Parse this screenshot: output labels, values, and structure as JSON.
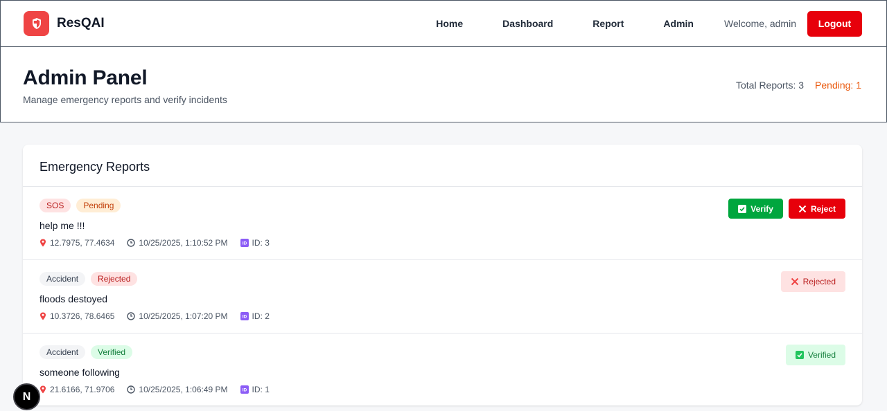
{
  "brand": {
    "name": "ResQAI"
  },
  "nav": {
    "home": "Home",
    "dashboard": "Dashboard",
    "report": "Report",
    "admin": "Admin",
    "welcome": "Welcome, admin",
    "logout": "Logout"
  },
  "header": {
    "title": "Admin Panel",
    "subtitle": "Manage emergency reports and verify incidents",
    "total_reports": "Total Reports: 3",
    "pending": "Pending: 1"
  },
  "reports_card": {
    "title": "Emergency Reports",
    "verify_label": "Verify",
    "reject_label": "Reject",
    "reports": [
      {
        "type": "SOS",
        "status": "Pending",
        "description": "help me !!!",
        "coords": "12.7975, 77.4634",
        "timestamp": "10/25/2025, 1:10:52 PM",
        "id": "ID: 3"
      },
      {
        "type": "Accident",
        "status": "Rejected",
        "description": "floods destoyed",
        "coords": "10.3726, 78.6465",
        "timestamp": "10/25/2025, 1:07:20 PM",
        "id": "ID: 2",
        "status_tag": "Rejected"
      },
      {
        "type": "Accident",
        "status": "Verified",
        "description": "someone following",
        "coords": "21.6166, 71.9706",
        "timestamp": "10/25/2025, 1:06:49 PM",
        "id": "ID: 1",
        "status_tag": "Verified"
      }
    ]
  },
  "fab": {
    "label": "N"
  },
  "colors": {
    "accent_red": "#e7000b",
    "verify_green": "#00a63e",
    "pending_orange": "#ea580c"
  },
  "icons": {
    "logo": "shield-icon",
    "location": "pin-icon",
    "time": "clock-icon",
    "id": "id-icon",
    "verify": "check-icon",
    "reject": "close-icon"
  }
}
